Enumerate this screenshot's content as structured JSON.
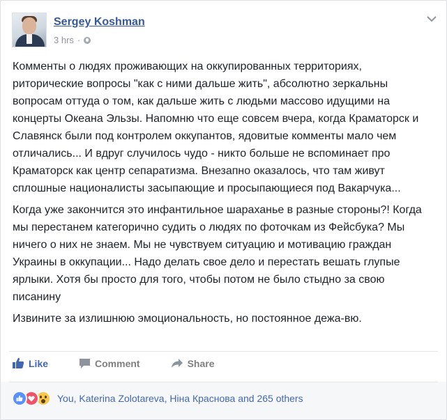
{
  "post": {
    "author": "Sergey Koshman",
    "timestamp": "3 hrs",
    "separator": "·",
    "privacy_icon": "globe-icon",
    "menu_icon": "chevron-down-icon",
    "paragraphs": [
      "Комменты о людях проживающих на оккупированных территориях, риторические вопросы \"как с ними дальше жить\", абсолютно зеркальны вопросам оттуда о том, как дальше жить с людьми массово идущими на концерты Океана Эльзы. Напомню что еще совсем вчера, когда Краматорск и Славянск были под контролем оккупантов, ядовитые комменты мало чем отличались... И вдруг случилось чудо - никто больше не вспоминает про Краматорск как центр сепаратизма. Внезапно оказалось, что там живут сплошные националисты засыпающие и просыпающиеся под Вакарчука...",
      "Когда уже закончится это инфантильное шараханье в разные стороны?! Когда мы перестанем категорично судить о людях по фоточкам из Фейсбука? Мы ничего о них не знаем. Мы не чувствуем ситуацию и мотивацию граждан Украины в оккупации... Надо делать свое дело и перестать вешать глупые ярлыки. Хотя бы просто для того, чтобы потом не было стыдно за свою писанину",
      "Извините за излишнюю эмоциональность, но постоянное дежа-вю."
    ]
  },
  "actions": {
    "like": "Like",
    "comment": "Comment",
    "share": "Share"
  },
  "reactions": {
    "icons": [
      "like-icon",
      "love-icon",
      "wow-icon"
    ],
    "summary": "You, Katerina Zolotareva, Ніна Краснова and 265 others"
  },
  "colors": {
    "link": "#365899",
    "like_blue": "#4267b2",
    "text": "#1d2129",
    "muted": "#90949c"
  }
}
